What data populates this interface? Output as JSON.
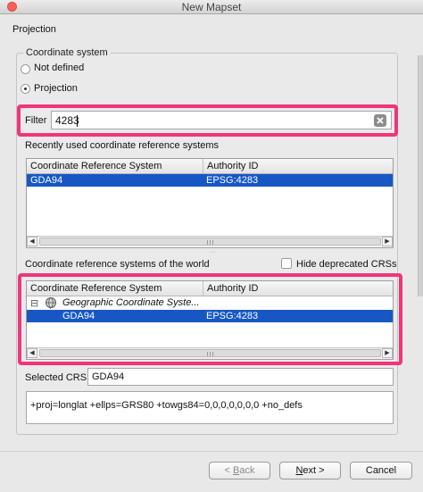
{
  "window": {
    "title": "New Mapset"
  },
  "page": {
    "heading": "Projection"
  },
  "coordinate_system": {
    "group_label": "Coordinate system",
    "options": [
      {
        "label": "Not defined",
        "selected": false
      },
      {
        "label": "Projection",
        "selected": true
      }
    ]
  },
  "filter": {
    "label": "Filter",
    "value": "4283",
    "clear_icon": "clear-icon"
  },
  "recent": {
    "title": "Recently used coordinate reference systems",
    "columns": [
      "Coordinate Reference System",
      "Authority ID"
    ],
    "rows": [
      {
        "crs": "GDA94",
        "authority": "EPSG:4283",
        "selected": true
      }
    ]
  },
  "world": {
    "title": "Coordinate reference systems of the world",
    "hide_deprecated_label": "Hide deprecated CRSs",
    "hide_deprecated_checked": false,
    "columns": [
      "Coordinate Reference System",
      "Authority ID"
    ],
    "group_row": {
      "expander": "⊟",
      "label": "Geographic Coordinate Syste..."
    },
    "rows": [
      {
        "crs": "GDA94",
        "authority": "EPSG:4283",
        "selected": true
      }
    ]
  },
  "selected_crs": {
    "label": "Selected CRS:",
    "value": "GDA94"
  },
  "proj_string": "+proj=longlat +ellps=GRS80 +towgs84=0,0,0,0,0,0,0 +no_defs",
  "buttons": {
    "back": {
      "pre": "< ",
      "mnemonic": "B",
      "rest": "ack"
    },
    "next": {
      "mnemonic": "N",
      "rest": "ext >"
    },
    "cancel": {
      "label": "Cancel"
    }
  },
  "colors": {
    "highlight_border": "#f0357a",
    "selection": "#1657c4"
  }
}
